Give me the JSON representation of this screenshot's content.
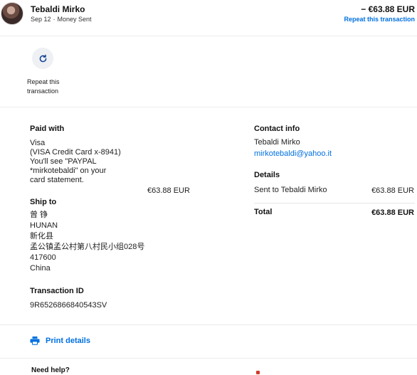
{
  "header": {
    "name": "Tebaldi Mirko",
    "date": "Sep 12",
    "type": "Money Sent",
    "amount": "− €63.88 EUR",
    "repeat_link": "Repeat this transaction"
  },
  "actions": {
    "repeat_label": "Repeat this transaction",
    "icon": "refresh-icon"
  },
  "paid_with": {
    "title": "Paid with",
    "lines": [
      "Visa",
      "(VISA Credit Card x-8941)",
      "You'll see \"PAYPAL",
      "*mirkotebaldi\" on your",
      "card statement."
    ],
    "amount": "€63.88 EUR"
  },
  "ship_to": {
    "title": "Ship to",
    "lines": [
      "曾 铮",
      "HUNAN",
      "新化县",
      "孟公镇孟公村第八村民小组028号",
      "417600",
      "China"
    ]
  },
  "transaction": {
    "title": "Transaction ID",
    "id": "9R6526866840543SV"
  },
  "contact": {
    "title": "Contact info",
    "name": "Tebaldi Mirko",
    "email": "mirkotebaldi@yahoo.it"
  },
  "details": {
    "title": "Details",
    "sent_label": "Sent to Tebaldi Mirko",
    "sent_amount": "€63.88 EUR",
    "total_label": "Total",
    "total_amount": "€63.88 EUR"
  },
  "print": {
    "label": "Print details",
    "icon": "printer-icon"
  },
  "help": {
    "title": "Need help?"
  },
  "colors": {
    "link": "#0070e0",
    "divider": "#ececec",
    "icon_bg": "#eef0f3"
  }
}
